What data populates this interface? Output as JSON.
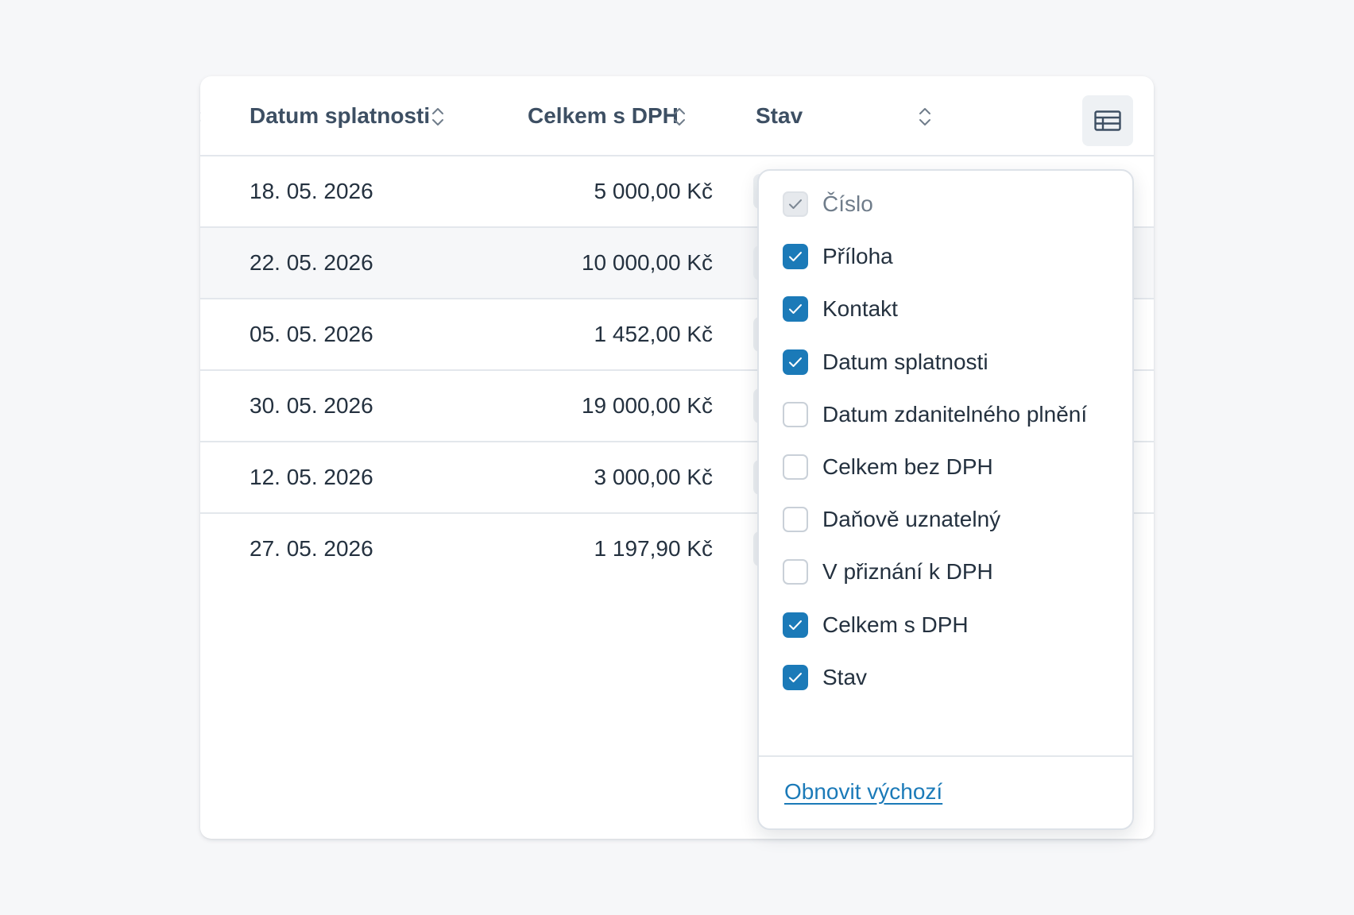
{
  "table": {
    "headers": {
      "due_date": "Datum splatnosti",
      "total_with_vat": "Celkem s DPH",
      "status": "Stav"
    },
    "rows": [
      {
        "due_date": "18. 05. 2026",
        "total_with_vat": "5 000,00 Kč"
      },
      {
        "due_date": "22. 05. 2026",
        "total_with_vat": "10 000,00 Kč"
      },
      {
        "due_date": "05. 05. 2026",
        "total_with_vat": "1 452,00 Kč"
      },
      {
        "due_date": "30. 05. 2026",
        "total_with_vat": "19 000,00 Kč"
      },
      {
        "due_date": "12. 05. 2026",
        "total_with_vat": "3 000,00 Kč"
      },
      {
        "due_date": "27. 05. 2026",
        "total_with_vat": "1 197,90 Kč"
      }
    ]
  },
  "column_picker": {
    "button_icon": "table-columns-icon",
    "options": [
      {
        "label": "Číslo",
        "checked": true,
        "disabled": true
      },
      {
        "label": "Příloha",
        "checked": true,
        "disabled": false
      },
      {
        "label": "Kontakt",
        "checked": true,
        "disabled": false
      },
      {
        "label": "Datum splatnosti",
        "checked": true,
        "disabled": false
      },
      {
        "label": "Datum zdanitelného plnění",
        "checked": false,
        "disabled": false
      },
      {
        "label": "Celkem bez DPH",
        "checked": false,
        "disabled": false
      },
      {
        "label": "Daňově uznatelný",
        "checked": false,
        "disabled": false
      },
      {
        "label": "V přiznání k DPH",
        "checked": false,
        "disabled": false
      },
      {
        "label": "Celkem s DPH",
        "checked": true,
        "disabled": false
      },
      {
        "label": "Stav",
        "checked": true,
        "disabled": false
      }
    ],
    "reset_label": "Obnovit výchozí"
  },
  "colors": {
    "accent": "#1b7ab8",
    "header_text": "#3d4f63",
    "body_text": "#24313f",
    "border": "#e3e7ec"
  }
}
